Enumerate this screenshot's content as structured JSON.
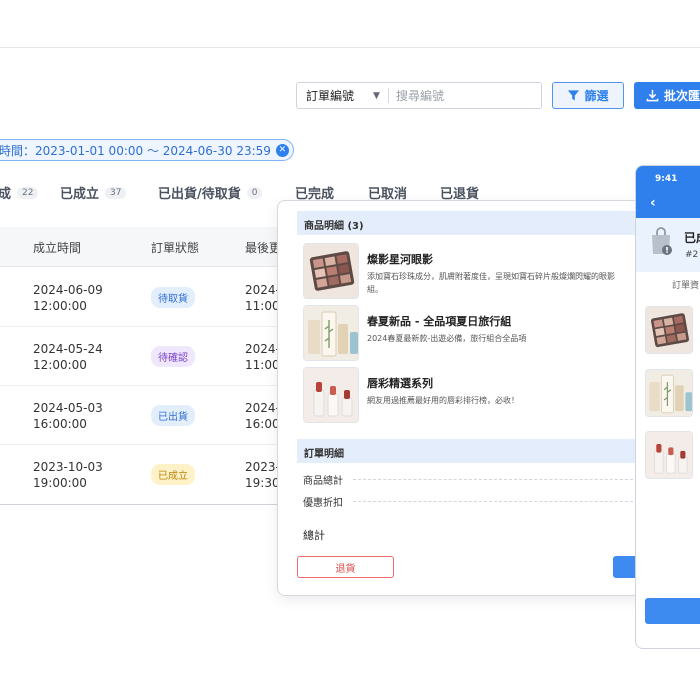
{
  "toolbar": {
    "search_field_selected": "訂單編號",
    "search_placeholder": "搜尋編號",
    "filter_label": "篩選",
    "batch_label": "批次匯"
  },
  "filter_chip": {
    "label": "時間：2023-01-01 00:00 〜 2024-06-30 23:59"
  },
  "tabs": [
    {
      "label": "",
      "count": "22"
    },
    {
      "label": "已成立",
      "count": "37"
    },
    {
      "label": "已出貨/待取貨",
      "count": "0"
    },
    {
      "label": "已完成",
      "count": ""
    },
    {
      "label": "已取消",
      "count": ""
    },
    {
      "label": "已退貨",
      "count": ""
    }
  ],
  "table": {
    "columns": [
      "成立時間",
      "訂單狀態",
      "最後更"
    ],
    "rows": [
      {
        "created_date": "2024-06-09",
        "created_time": "12:00:00",
        "status": "待取貨",
        "updated_date": "2024-0",
        "updated_time": "11:00:"
      },
      {
        "created_date": "2024-05-24",
        "created_time": "12:00:00",
        "status": "待確認",
        "updated_date": "2024-0",
        "updated_time": "11:00:"
      },
      {
        "created_date": "2024-05-03",
        "created_time": "16:00:00",
        "status": "已出貨",
        "updated_date": "2024-0",
        "updated_time": "16:00:"
      },
      {
        "created_date": "2023-10-03",
        "created_time": "19:00:00",
        "status": "已成立",
        "updated_date": "2023-1",
        "updated_time": "19:30:"
      }
    ]
  },
  "status_colors": {
    "待取貨": {
      "bg": "#e3eefc",
      "fg": "#2f6fd1"
    },
    "待確認": {
      "bg": "#efe7fb",
      "fg": "#7b45c9"
    },
    "已出貨": {
      "bg": "#e3eefc",
      "fg": "#2f6fd1"
    },
    "已成立": {
      "bg": "#fff2c9",
      "fg": "#b8860b"
    }
  },
  "detail": {
    "products_header": "商品明細 (3)",
    "products": [
      {
        "name": "燦影星河眼影",
        "desc": "添加寶石珍珠成分，肌膚附著度佳，呈現如寶石碎片般燦爛閃耀的眼影組。",
        "icon": "eyeshadow-palette-icon"
      },
      {
        "name": "春夏新品 - 全品項夏日旅行組",
        "desc": "2024春夏最新款-出遊必備，旅行組合全品項",
        "icon": "travel-set-icon"
      },
      {
        "name": "唇彩精選系列",
        "desc": "網友用過推薦最好用的唇彩排行榜，必收！",
        "icon": "lipstick-icon"
      }
    ],
    "order_header": "訂單明細",
    "subtotal_label": "商品總計",
    "discount_label": "優惠折扣",
    "total_label": "總計",
    "return_label": "退貨"
  },
  "phone": {
    "time": "9:41",
    "back_icon": "chevron-left-icon",
    "status": "已成",
    "order_no": "#2",
    "section_label": "訂單資"
  },
  "colors": {
    "primary": "#2f80ed",
    "danger": "#e04848"
  }
}
